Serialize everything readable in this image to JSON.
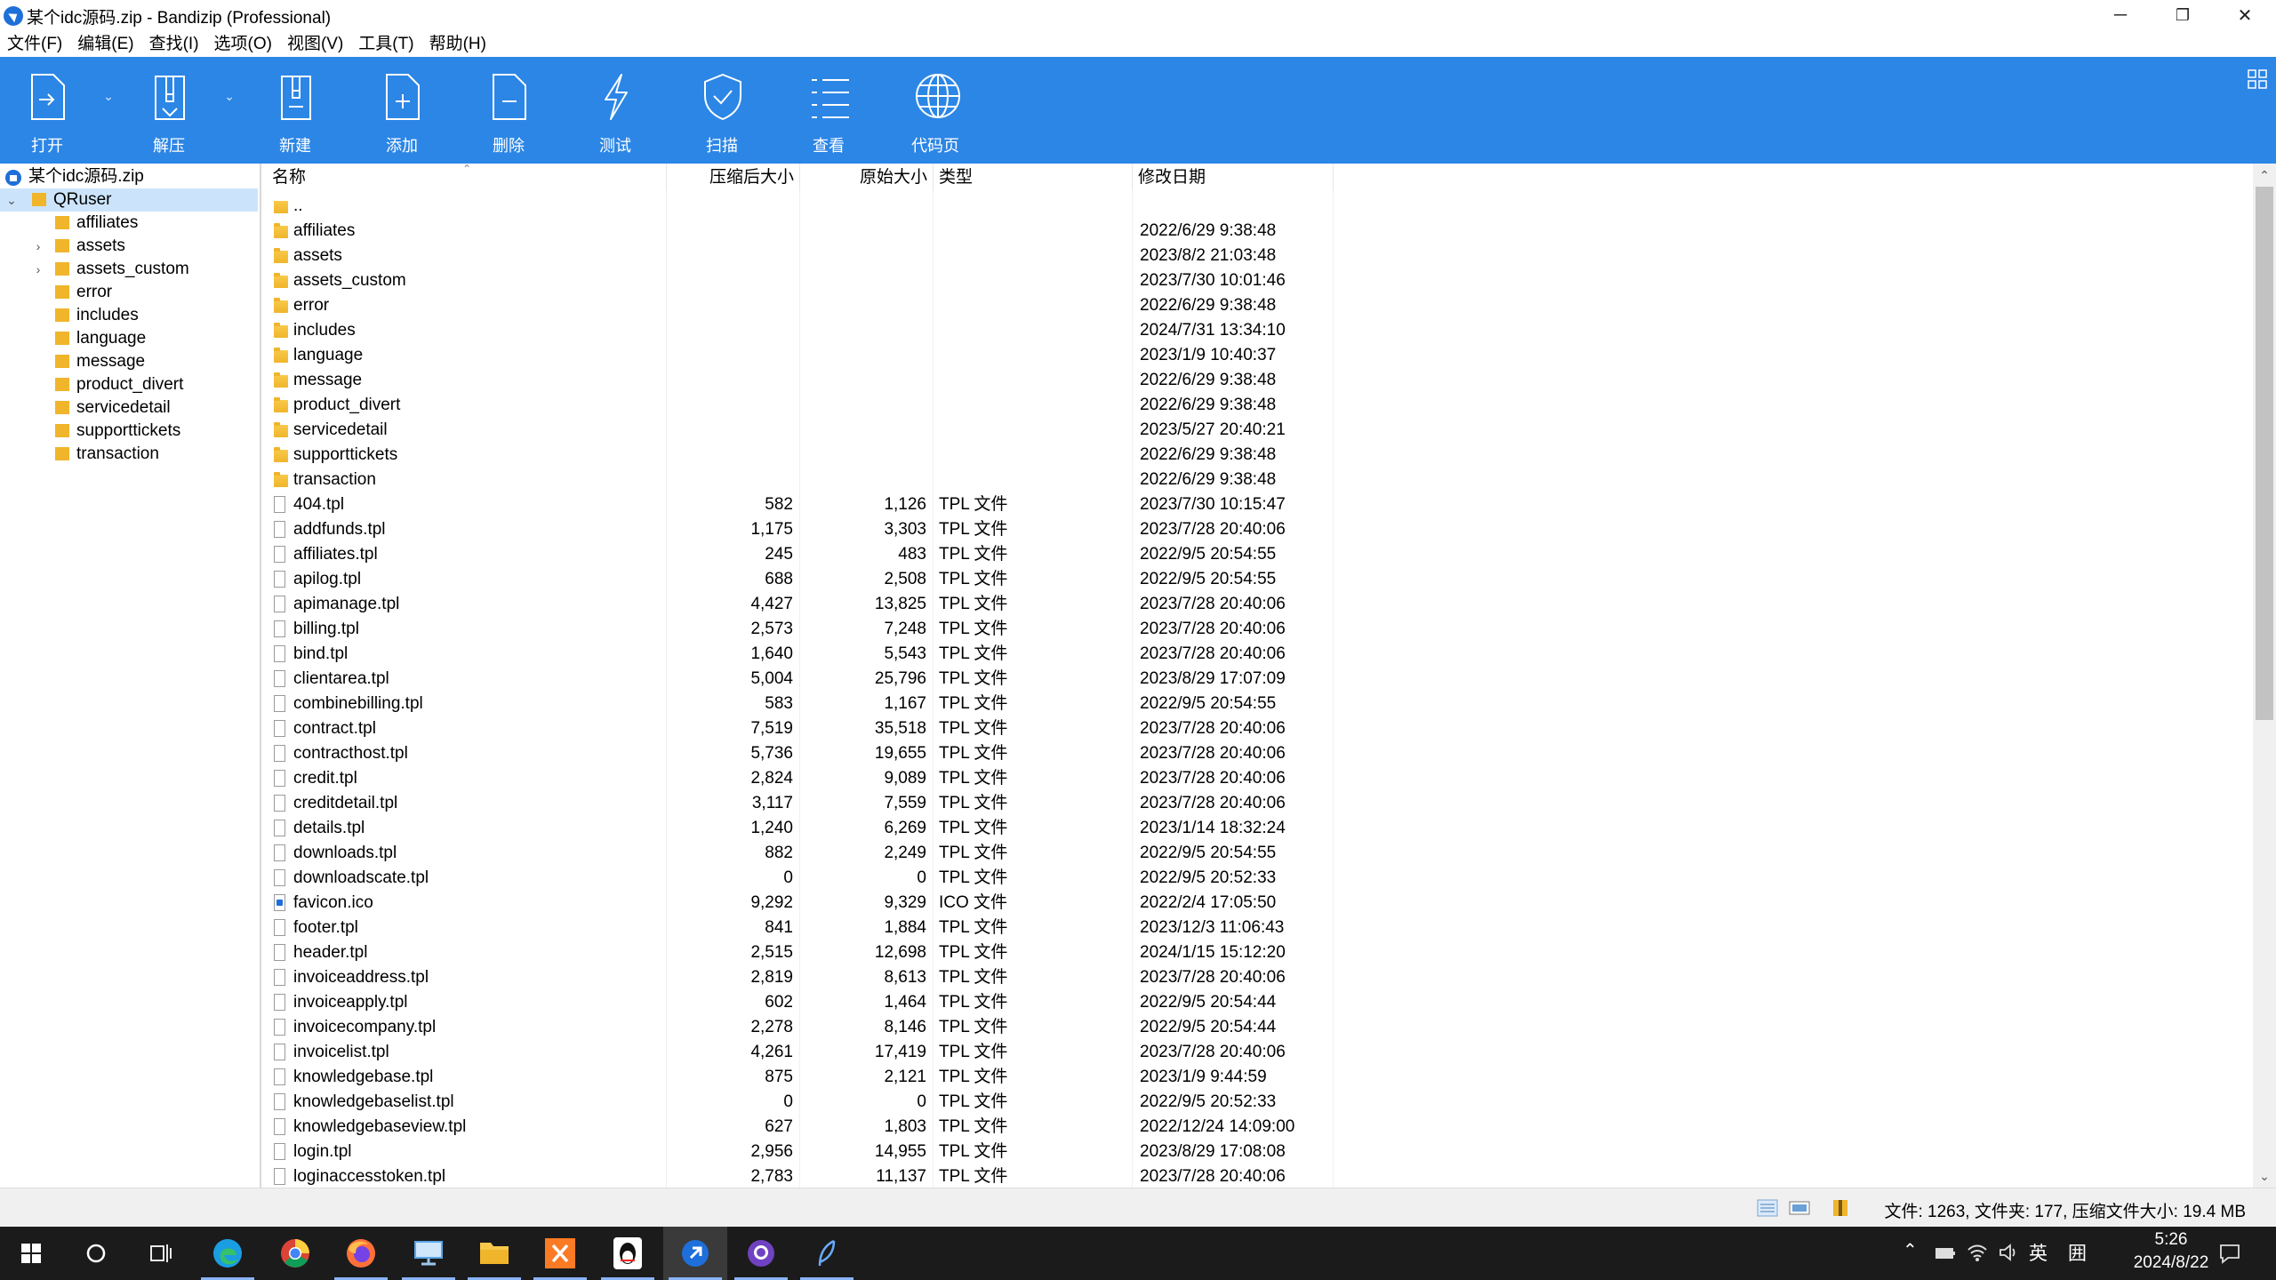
{
  "window": {
    "title": "某个idc源码.zip - Bandizip (Professional)",
    "minimize": "─",
    "maximize": "❐",
    "close": "✕"
  },
  "menu": [
    "文件(F)",
    "编辑(E)",
    "查找(I)",
    "选项(O)",
    "视图(V)",
    "工具(T)",
    "帮助(H)"
  ],
  "toolbar": {
    "open": "打开",
    "extract": "解压",
    "new": "新建",
    "add": "添加",
    "delete": "删除",
    "test": "测试",
    "scan": "扫描",
    "view": "查看",
    "codepage": "代码页"
  },
  "tree": {
    "root": "某个idc源码.zip",
    "selected": "QRuser",
    "children": [
      {
        "label": "affiliates",
        "expandable": false
      },
      {
        "label": "assets",
        "expandable": true
      },
      {
        "label": "assets_custom",
        "expandable": true
      },
      {
        "label": "error",
        "expandable": false
      },
      {
        "label": "includes",
        "expandable": false
      },
      {
        "label": "language",
        "expandable": false
      },
      {
        "label": "message",
        "expandable": false
      },
      {
        "label": "product_divert",
        "expandable": false
      },
      {
        "label": "servicedetail",
        "expandable": false
      },
      {
        "label": "supporttickets",
        "expandable": false
      },
      {
        "label": "transaction",
        "expandable": false
      }
    ]
  },
  "columns": {
    "name": "名称",
    "packed": "压缩后大小",
    "size": "原始大小",
    "type": "类型",
    "modified": "修改日期"
  },
  "files": [
    {
      "name": "..",
      "kind": "up",
      "packed": "",
      "size": "",
      "type": "",
      "modified": ""
    },
    {
      "name": "affiliates",
      "kind": "folder",
      "packed": "",
      "size": "",
      "type": "",
      "modified": "2022/6/29 9:38:48"
    },
    {
      "name": "assets",
      "kind": "folder",
      "packed": "",
      "size": "",
      "type": "",
      "modified": "2023/8/2 21:03:48"
    },
    {
      "name": "assets_custom",
      "kind": "folder",
      "packed": "",
      "size": "",
      "type": "",
      "modified": "2023/7/30 10:01:46"
    },
    {
      "name": "error",
      "kind": "folder",
      "packed": "",
      "size": "",
      "type": "",
      "modified": "2022/6/29 9:38:48"
    },
    {
      "name": "includes",
      "kind": "folder",
      "packed": "",
      "size": "",
      "type": "",
      "modified": "2024/7/31 13:34:10"
    },
    {
      "name": "language",
      "kind": "folder",
      "packed": "",
      "size": "",
      "type": "",
      "modified": "2023/1/9 10:40:37"
    },
    {
      "name": "message",
      "kind": "folder",
      "packed": "",
      "size": "",
      "type": "",
      "modified": "2022/6/29 9:38:48"
    },
    {
      "name": "product_divert",
      "kind": "folder",
      "packed": "",
      "size": "",
      "type": "",
      "modified": "2022/6/29 9:38:48"
    },
    {
      "name": "servicedetail",
      "kind": "folder",
      "packed": "",
      "size": "",
      "type": "",
      "modified": "2023/5/27 20:40:21"
    },
    {
      "name": "supporttickets",
      "kind": "folder",
      "packed": "",
      "size": "",
      "type": "",
      "modified": "2022/6/29 9:38:48"
    },
    {
      "name": "transaction",
      "kind": "folder",
      "packed": "",
      "size": "",
      "type": "",
      "modified": "2022/6/29 9:38:48"
    },
    {
      "name": "404.tpl",
      "kind": "file",
      "packed": "582",
      "size": "1,126",
      "type": "TPL 文件",
      "modified": "2023/7/30 10:15:47"
    },
    {
      "name": "addfunds.tpl",
      "kind": "file",
      "packed": "1,175",
      "size": "3,303",
      "type": "TPL 文件",
      "modified": "2023/7/28 20:40:06"
    },
    {
      "name": "affiliates.tpl",
      "kind": "file",
      "packed": "245",
      "size": "483",
      "type": "TPL 文件",
      "modified": "2022/9/5 20:54:55"
    },
    {
      "name": "apilog.tpl",
      "kind": "file",
      "packed": "688",
      "size": "2,508",
      "type": "TPL 文件",
      "modified": "2022/9/5 20:54:55"
    },
    {
      "name": "apimanage.tpl",
      "kind": "file",
      "packed": "4,427",
      "size": "13,825",
      "type": "TPL 文件",
      "modified": "2023/7/28 20:40:06"
    },
    {
      "name": "billing.tpl",
      "kind": "file",
      "packed": "2,573",
      "size": "7,248",
      "type": "TPL 文件",
      "modified": "2023/7/28 20:40:06"
    },
    {
      "name": "bind.tpl",
      "kind": "file",
      "packed": "1,640",
      "size": "5,543",
      "type": "TPL 文件",
      "modified": "2023/7/28 20:40:06"
    },
    {
      "name": "clientarea.tpl",
      "kind": "file",
      "packed": "5,004",
      "size": "25,796",
      "type": "TPL 文件",
      "modified": "2023/8/29 17:07:09"
    },
    {
      "name": "combinebilling.tpl",
      "kind": "file",
      "packed": "583",
      "size": "1,167",
      "type": "TPL 文件",
      "modified": "2022/9/5 20:54:55"
    },
    {
      "name": "contract.tpl",
      "kind": "file",
      "packed": "7,519",
      "size": "35,518",
      "type": "TPL 文件",
      "modified": "2023/7/28 20:40:06"
    },
    {
      "name": "contracthost.tpl",
      "kind": "file",
      "packed": "5,736",
      "size": "19,655",
      "type": "TPL 文件",
      "modified": "2023/7/28 20:40:06"
    },
    {
      "name": "credit.tpl",
      "kind": "file",
      "packed": "2,824",
      "size": "9,089",
      "type": "TPL 文件",
      "modified": "2023/7/28 20:40:06"
    },
    {
      "name": "creditdetail.tpl",
      "kind": "file",
      "packed": "3,117",
      "size": "7,559",
      "type": "TPL 文件",
      "modified": "2023/7/28 20:40:06"
    },
    {
      "name": "details.tpl",
      "kind": "file",
      "packed": "1,240",
      "size": "6,269",
      "type": "TPL 文件",
      "modified": "2023/1/14 18:32:24"
    },
    {
      "name": "downloads.tpl",
      "kind": "file",
      "packed": "882",
      "size": "2,249",
      "type": "TPL 文件",
      "modified": "2022/9/5 20:54:55"
    },
    {
      "name": "downloadscate.tpl",
      "kind": "file",
      "packed": "0",
      "size": "0",
      "type": "TPL 文件",
      "modified": "2022/9/5 20:52:33"
    },
    {
      "name": "favicon.ico",
      "kind": "ico",
      "packed": "9,292",
      "size": "9,329",
      "type": "ICO 文件",
      "modified": "2022/2/4 17:05:50"
    },
    {
      "name": "footer.tpl",
      "kind": "file",
      "packed": "841",
      "size": "1,884",
      "type": "TPL 文件",
      "modified": "2023/12/3 11:06:43"
    },
    {
      "name": "header.tpl",
      "kind": "file",
      "packed": "2,515",
      "size": "12,698",
      "type": "TPL 文件",
      "modified": "2024/1/15 15:12:20"
    },
    {
      "name": "invoiceaddress.tpl",
      "kind": "file",
      "packed": "2,819",
      "size": "8,613",
      "type": "TPL 文件",
      "modified": "2023/7/28 20:40:06"
    },
    {
      "name": "invoiceapply.tpl",
      "kind": "file",
      "packed": "602",
      "size": "1,464",
      "type": "TPL 文件",
      "modified": "2022/9/5 20:54:44"
    },
    {
      "name": "invoicecompany.tpl",
      "kind": "file",
      "packed": "2,278",
      "size": "8,146",
      "type": "TPL 文件",
      "modified": "2022/9/5 20:54:44"
    },
    {
      "name": "invoicelist.tpl",
      "kind": "file",
      "packed": "4,261",
      "size": "17,419",
      "type": "TPL 文件",
      "modified": "2023/7/28 20:40:06"
    },
    {
      "name": "knowledgebase.tpl",
      "kind": "file",
      "packed": "875",
      "size": "2,121",
      "type": "TPL 文件",
      "modified": "2023/1/9 9:44:59"
    },
    {
      "name": "knowledgebaselist.tpl",
      "kind": "file",
      "packed": "0",
      "size": "0",
      "type": "TPL 文件",
      "modified": "2022/9/5 20:52:33"
    },
    {
      "name": "knowledgebaseview.tpl",
      "kind": "file",
      "packed": "627",
      "size": "1,803",
      "type": "TPL 文件",
      "modified": "2022/12/24 14:09:00"
    },
    {
      "name": "login.tpl",
      "kind": "file",
      "packed": "2,956",
      "size": "14,955",
      "type": "TPL 文件",
      "modified": "2023/8/29 17:08:08"
    },
    {
      "name": "loginaccesstoken.tpl",
      "kind": "file",
      "packed": "2,783",
      "size": "11,137",
      "type": "TPL 文件",
      "modified": "2023/7/28 20:40:06"
    }
  ],
  "status": "文件: 1263, 文件夹: 177, 压缩文件大小: 19.4 MB",
  "taskbar": {
    "apps": [
      "windows-start",
      "search",
      "task-view",
      "edge",
      "chrome",
      "firefox",
      "remote-desktop",
      "file-explorer",
      "xampp",
      "qq",
      "bandizip",
      "github-desktop",
      "feather"
    ],
    "ime_lang": "英",
    "ime_mode": "囲",
    "time": "5:26",
    "date": "2024/8/22"
  },
  "colors": {
    "toolbar_bg": "#2c86e6",
    "selection": "#cce4fb",
    "folder": "#f0b52b",
    "taskbar": "#1b1b1b"
  }
}
